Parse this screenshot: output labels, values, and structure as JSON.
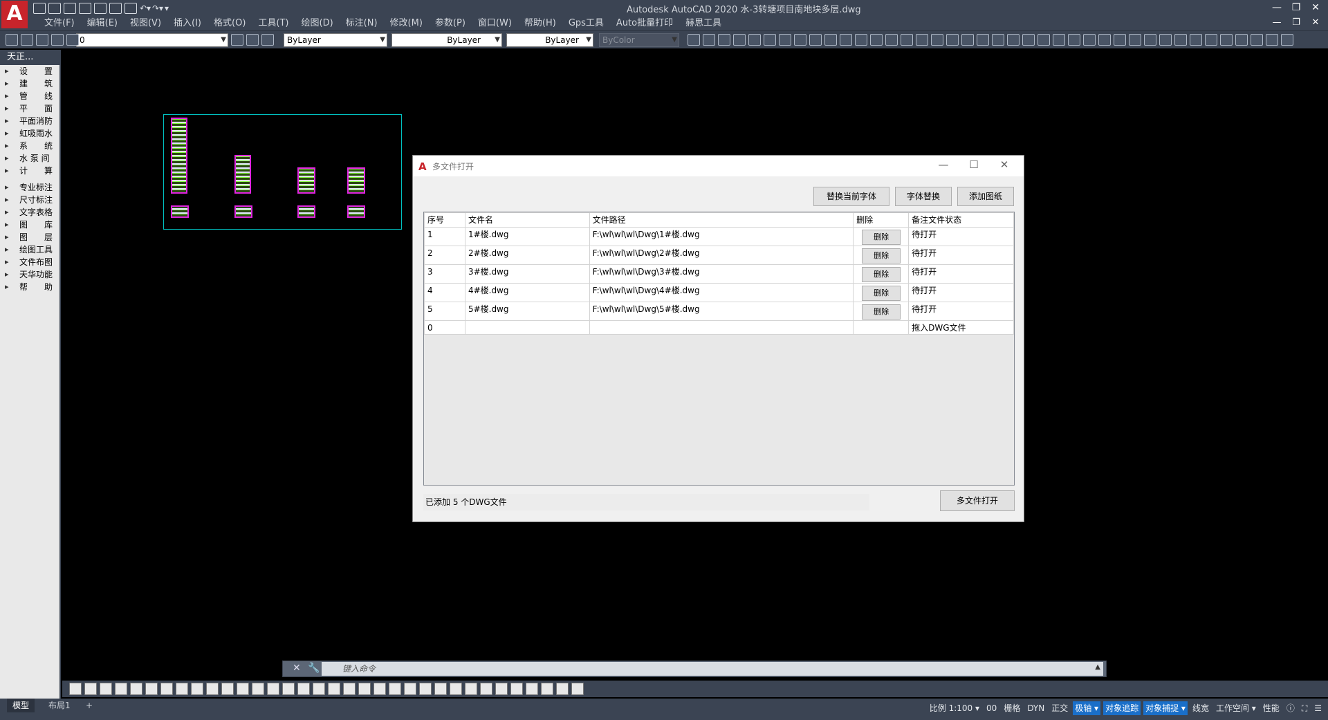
{
  "window": {
    "title": "Autodesk AutoCAD 2020    水-3转塘项目南地块多层.dwg",
    "logo": "A",
    "controls": [
      "—",
      "❐",
      "✕"
    ],
    "doc_controls": [
      "—",
      "❐",
      "✕"
    ]
  },
  "menu": [
    "文件(F)",
    "编辑(E)",
    "视图(V)",
    "插入(I)",
    "格式(O)",
    "工具(T)",
    "绘图(D)",
    "标注(N)",
    "修改(M)",
    "参数(P)",
    "窗口(W)",
    "帮助(H)",
    "Gps工具",
    "Auto批量打印",
    "赫思工具"
  ],
  "toolbar": {
    "layer": "0",
    "color": "ByLayer",
    "linetype": "ByLayer",
    "lineweight": "ByLayer",
    "plotstyle": "ByColor"
  },
  "palette": {
    "title": "天正...",
    "group1": [
      "设　　置",
      "建　　筑",
      "管　　线",
      "平　　面",
      "平面消防",
      "虹吸雨水",
      "系　　统",
      "水 泵 间",
      "计　　算"
    ],
    "group2": [
      "专业标注",
      "尺寸标注",
      "文字表格",
      "图　　库",
      "图　　层",
      "绘图工具",
      "文件布图",
      "天华功能",
      "帮　　助"
    ]
  },
  "dialog": {
    "logo": "A",
    "title": "多文件打开",
    "controls": [
      "—",
      "☐",
      "✕"
    ],
    "buttons": {
      "replace_current_font": "替换当前字体",
      "font_replace": "字体替换",
      "add_drawings": "添加图纸",
      "open_multiple": "多文件打开"
    },
    "columns": [
      "序号",
      "文件名",
      "文件路径",
      "删除",
      "备注文件状态"
    ],
    "rows": [
      {
        "no": "1",
        "name": "1#楼.dwg",
        "path": "F:\\wl\\wl\\wl\\Dwg\\1#楼.dwg",
        "del": "删除",
        "status": "待打开"
      },
      {
        "no": "2",
        "name": "2#楼.dwg",
        "path": "F:\\wl\\wl\\wl\\Dwg\\2#楼.dwg",
        "del": "删除",
        "status": "待打开"
      },
      {
        "no": "3",
        "name": "3#楼.dwg",
        "path": "F:\\wl\\wl\\wl\\Dwg\\3#楼.dwg",
        "del": "删除",
        "status": "待打开"
      },
      {
        "no": "4",
        "name": "4#楼.dwg",
        "path": "F:\\wl\\wl\\wl\\Dwg\\4#楼.dwg",
        "del": "删除",
        "status": "待打开"
      },
      {
        "no": "5",
        "name": "5#楼.dwg",
        "path": "F:\\wl\\wl\\wl\\Dwg\\5#楼.dwg",
        "del": "删除",
        "status": "待打开"
      }
    ],
    "empty_row": {
      "no": "0",
      "status": "拖入DWG文件"
    },
    "status_text": "已添加 5 个DWG文件"
  },
  "command": {
    "placeholder": "键入命令",
    "close": "✕",
    "wrench": "🔧",
    "up": "▲"
  },
  "statusbar": {
    "tabs": [
      "模型",
      "布局1",
      "+"
    ],
    "items": [
      "比例 1:100 ▾",
      "00",
      "栅格",
      "DYN",
      "正交",
      "极轴 ▾",
      "对象追踪",
      "对象捕捉 ▾",
      "线宽",
      "工作空间 ▾",
      "性能"
    ],
    "highlighted": [
      "极轴 ▾",
      "对象追踪",
      "对象捕捉 ▾"
    ]
  }
}
